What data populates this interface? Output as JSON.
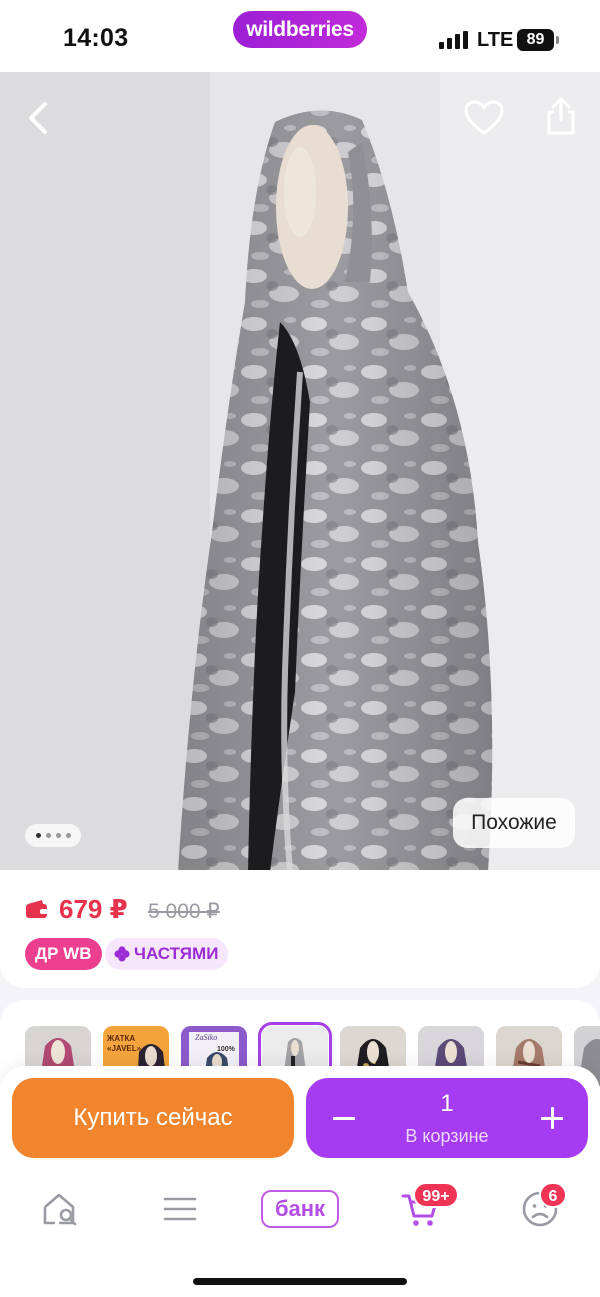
{
  "status_bar": {
    "time": "14:03",
    "brand": "wildberries",
    "network": "LTE",
    "battery": "89"
  },
  "product": {
    "gallery": {
      "total_images": 4,
      "current_index": 0,
      "similar_label": "Похожие"
    },
    "price": {
      "current": "679 ₽",
      "old": "5 000 ₽",
      "price_color": "#e6324b"
    },
    "badges": {
      "dr_wb": "ДР WB",
      "installments": "ЧАСТЯМИ"
    },
    "variants": [
      {
        "name": "variant-pink"
      },
      {
        "name": "variant-javel",
        "text_top": "ЖАТКА",
        "text_bottom": "«JAVEL»"
      },
      {
        "name": "variant-zasiko",
        "brand": "ZaSiko",
        "text": "100%"
      },
      {
        "name": "variant-grey-tiedye",
        "selected": true
      },
      {
        "name": "variant-black-print"
      },
      {
        "name": "variant-purple"
      },
      {
        "name": "variant-beige-print"
      },
      {
        "name": "variant-grey"
      }
    ]
  },
  "actions": {
    "buy_now": "Купить сейчас",
    "cart_qty": "1",
    "cart_label": "В корзине",
    "buy_color": "#f0852e",
    "cart_color": "#a53cf2"
  },
  "tabbar": {
    "bank_label": "банк",
    "cart_badge": "99+",
    "profile_badge": "6",
    "accent": "#a53cf2"
  }
}
